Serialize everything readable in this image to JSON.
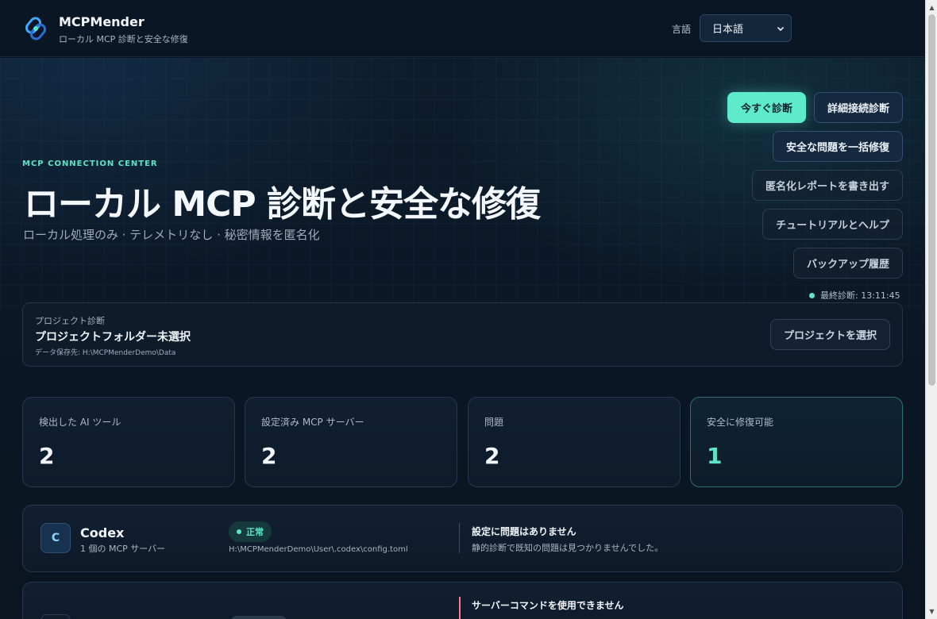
{
  "app": {
    "name": "MCPMender",
    "subtitle": "ローカル MCP 診断と安全な修復",
    "logo_icon": "chain-link-icon"
  },
  "language": {
    "label": "言語",
    "selected": "日本語"
  },
  "hero": {
    "eyebrow": "MCP CONNECTION CENTER",
    "title": "ローカル MCP 診断と安全な修復",
    "subtitle": "ローカル処理のみ · テレメトリなし · 秘密情報を匿名化"
  },
  "actions": {
    "diagnose_now": "今すぐ診断",
    "deep_diagnose": "詳細接続診断",
    "fix_safe": "安全な問題を一括修復",
    "export_report": "匿名化レポートを書き出す",
    "tutorial": "チュートリアルとヘルプ",
    "backup_history": "バックアップ履歴"
  },
  "status": {
    "last_diagnosis": "最終診断: 13:11:45",
    "dot_color": "#5ee5c7"
  },
  "project": {
    "kicker": "プロジェクト診断",
    "name": "プロジェクトフォルダー未選択",
    "data_path": "データ保存先: H:\\MCPMenderDemo\\Data",
    "select_button": "プロジェクトを選択"
  },
  "stats": [
    {
      "label": "検出した AI ツール",
      "value": "2"
    },
    {
      "label": "設定済み MCP サーバー",
      "value": "2"
    },
    {
      "label": "問題",
      "value": "2"
    },
    {
      "label": "安全に修復可能",
      "value": "1"
    }
  ],
  "tools": [
    {
      "initial": "C",
      "name": "Codex",
      "count": "1 個の MCP サーバー",
      "status": "正常",
      "config_path": "H:\\MCPMenderDemo\\User\\.codex\\config.toml",
      "message_title": "設定に問題はありません",
      "message_body": "静的診断で既知の問題は見つかりませんでした。"
    },
    {
      "message_title": "サーバーコマンドを使用できません"
    }
  ],
  "colors": {
    "accent": "#5ee5c7",
    "background": "#0b1522",
    "warning": "#ff7a8a"
  }
}
